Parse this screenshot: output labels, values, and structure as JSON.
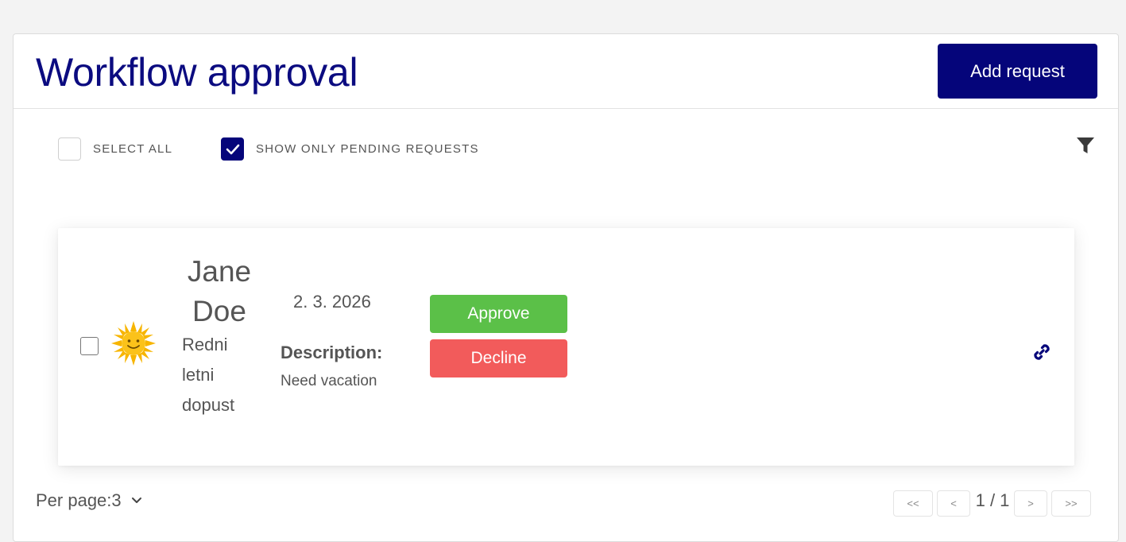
{
  "header": {
    "title": "Workflow approval",
    "add_button_label": "Add request"
  },
  "toolbar": {
    "select_all_label": "SELECT ALL",
    "select_all_checked": false,
    "pending_label": "SHOW ONLY PENDING REQUESTS",
    "pending_checked": true,
    "filter_icon": "filter-icon"
  },
  "requests": [
    {
      "first_name": "Jane",
      "last_name": "Doe",
      "type_icon": "sun-icon",
      "type_label": "Redni letni dopust",
      "date": "2. 3. 2026",
      "description_label": "Description:",
      "description": "Need vacation",
      "approve_label": "Approve",
      "decline_label": "Decline",
      "link_icon": "link-icon"
    }
  ],
  "footer": {
    "per_page_label": "Per page:3",
    "pager": {
      "first": "<<",
      "prev": "<",
      "info": "1 / 1",
      "next": ">",
      "last": ">>"
    }
  },
  "colors": {
    "brand": "#05057a",
    "title": "#0b0b80",
    "approve": "#5bc048",
    "decline": "#f25b5b"
  }
}
